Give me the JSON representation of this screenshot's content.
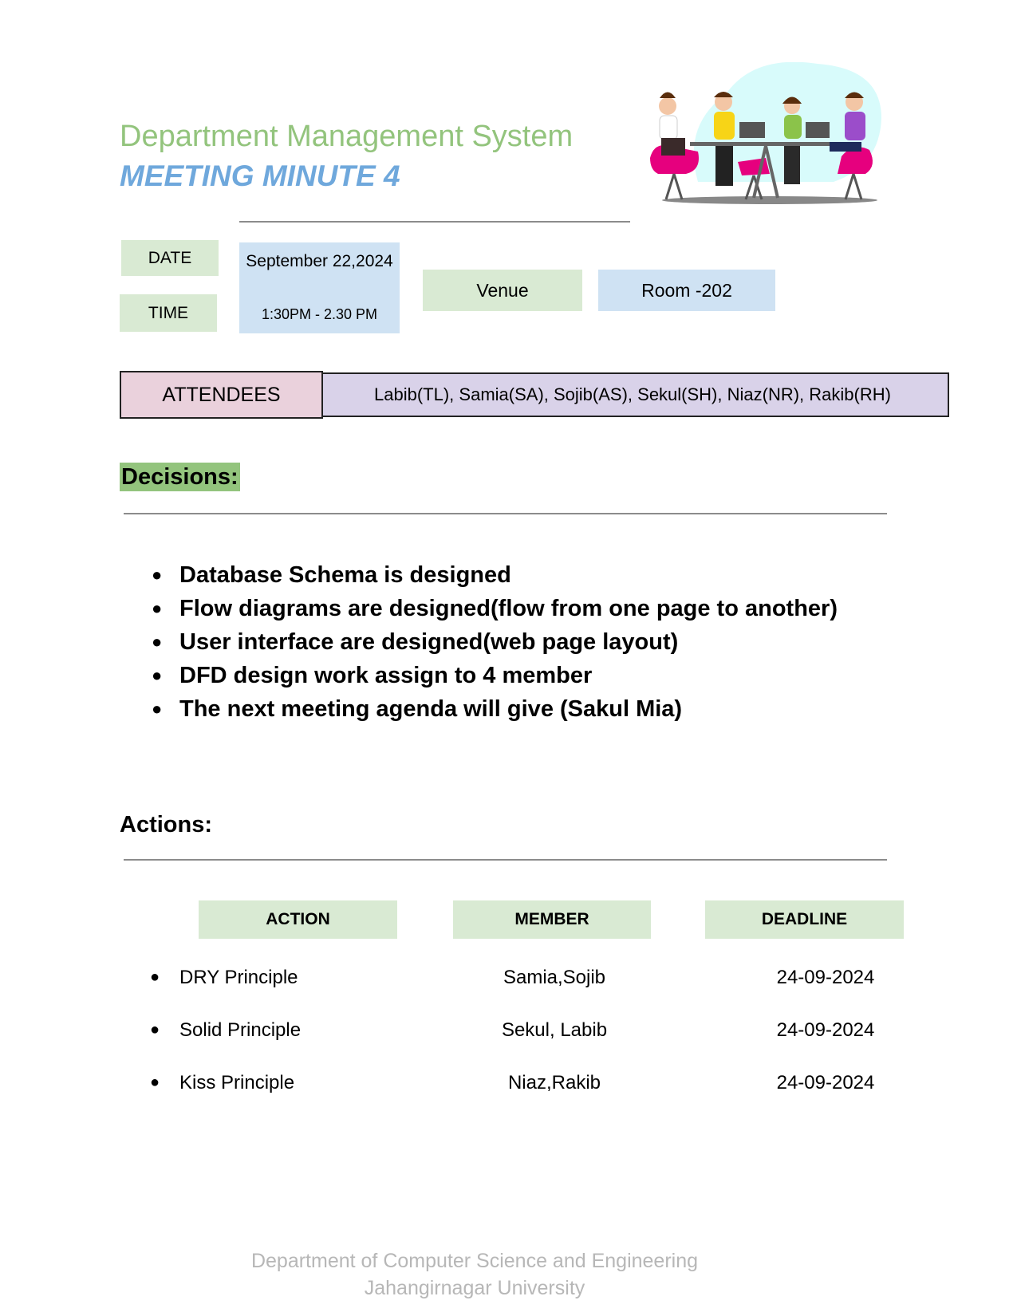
{
  "header": {
    "title": "Department Management  System",
    "subtitle": "MEETING MINUTE 4"
  },
  "meta": {
    "date_label": "DATE",
    "time_label": "TIME",
    "date_value": "September 22,2024",
    "time_value": "1:30PM - 2.30 PM",
    "venue_label": "Venue",
    "venue_value": "Room -202"
  },
  "attendees": {
    "label": "ATTENDEES",
    "value": "Labib(TL), Samia(SA), Sojib(AS), Sekul(SH), Niaz(NR), Rakib(RH)"
  },
  "decisions": {
    "title": "Decisions:",
    "items": [
      "Database Schema is designed",
      "Flow diagrams are designed(flow from one page to another)",
      "User interface are designed(web page layout)",
      "DFD design work assign to 4 member",
      "The next meeting agenda will give (Sakul Mia)"
    ]
  },
  "actions": {
    "title": "Actions:",
    "headers": {
      "action": "ACTION",
      "member": "MEMBER",
      "deadline": "DEADLINE"
    },
    "rows": [
      {
        "action": "DRY Principle",
        "member": "Samia,Sojib",
        "deadline": "24-09-2024"
      },
      {
        "action": "Solid Principle",
        "member": "Sekul, Labib",
        "deadline": "24-09-2024"
      },
      {
        "action": "Kiss Principle",
        "member": "Niaz,Rakib",
        "deadline": "24-09-2024"
      }
    ]
  },
  "footer": {
    "line1": "Department of Computer Science and Engineering",
    "line2": "Jahangirnagar University"
  }
}
